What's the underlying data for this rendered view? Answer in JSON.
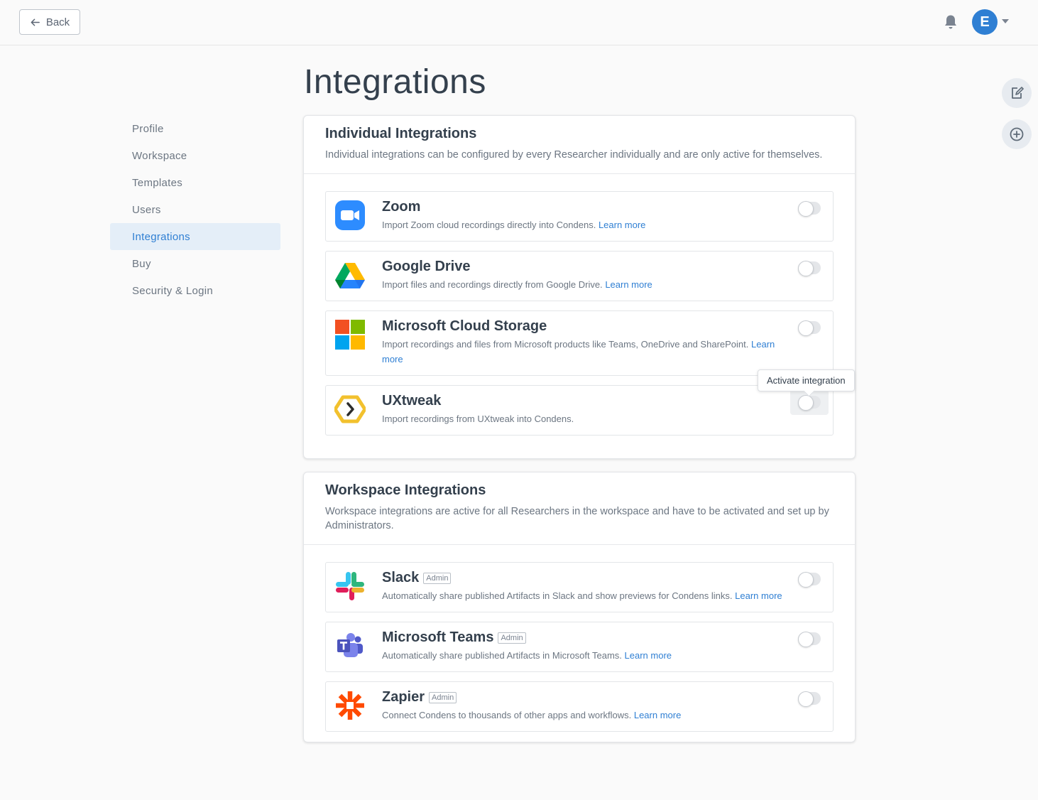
{
  "header": {
    "back_label": "Back",
    "avatar_initial": "E"
  },
  "page": {
    "title": "Integrations"
  },
  "nav": {
    "items": [
      {
        "label": "Profile",
        "active": false
      },
      {
        "label": "Workspace",
        "active": false
      },
      {
        "label": "Templates",
        "active": false
      },
      {
        "label": "Users",
        "active": false
      },
      {
        "label": "Integrations",
        "active": true
      },
      {
        "label": "Buy",
        "active": false
      },
      {
        "label": "Security & Login",
        "active": false
      }
    ]
  },
  "individual": {
    "title": "Individual Integrations",
    "description": "Individual integrations can be configured by every Researcher individually and are only active for themselves.",
    "items": [
      {
        "name": "Zoom",
        "desc": "Import Zoom cloud recordings directly into Condens.",
        "link": "Learn more",
        "enabled": false
      },
      {
        "name": "Google Drive",
        "desc": "Import files and recordings directly from Google Drive.",
        "link": "Learn more",
        "enabled": false
      },
      {
        "name": "Microsoft Cloud Storage",
        "desc": "Import recordings and files from Microsoft products like Teams, OneDrive and SharePoint.",
        "link": "Learn more",
        "enabled": false
      },
      {
        "name": "UXtweak",
        "desc": "Import recordings from UXtweak into Condens.",
        "link": "",
        "enabled": false
      }
    ]
  },
  "workspace": {
    "title": "Workspace Integrations",
    "description": "Workspace integrations are active for all Researchers in the workspace and have to be activated and set up by Administrators.",
    "admin_badge": "Admin",
    "items": [
      {
        "name": "Slack",
        "desc": "Automatically share published Artifacts in Slack and show previews for Condens links.",
        "link": "Learn more",
        "enabled": false
      },
      {
        "name": "Microsoft Teams",
        "desc": "Automatically share published Artifacts in Microsoft Teams.",
        "link": "Learn more",
        "enabled": false
      },
      {
        "name": "Zapier",
        "desc": "Connect Condens to thousands of other apps and workflows.",
        "link": "Learn more",
        "enabled": false
      }
    ]
  },
  "tooltip": {
    "text": "Activate integration"
  },
  "colors": {
    "accent": "#2f7fd3",
    "active_nav_bg": "#e4eef8"
  }
}
